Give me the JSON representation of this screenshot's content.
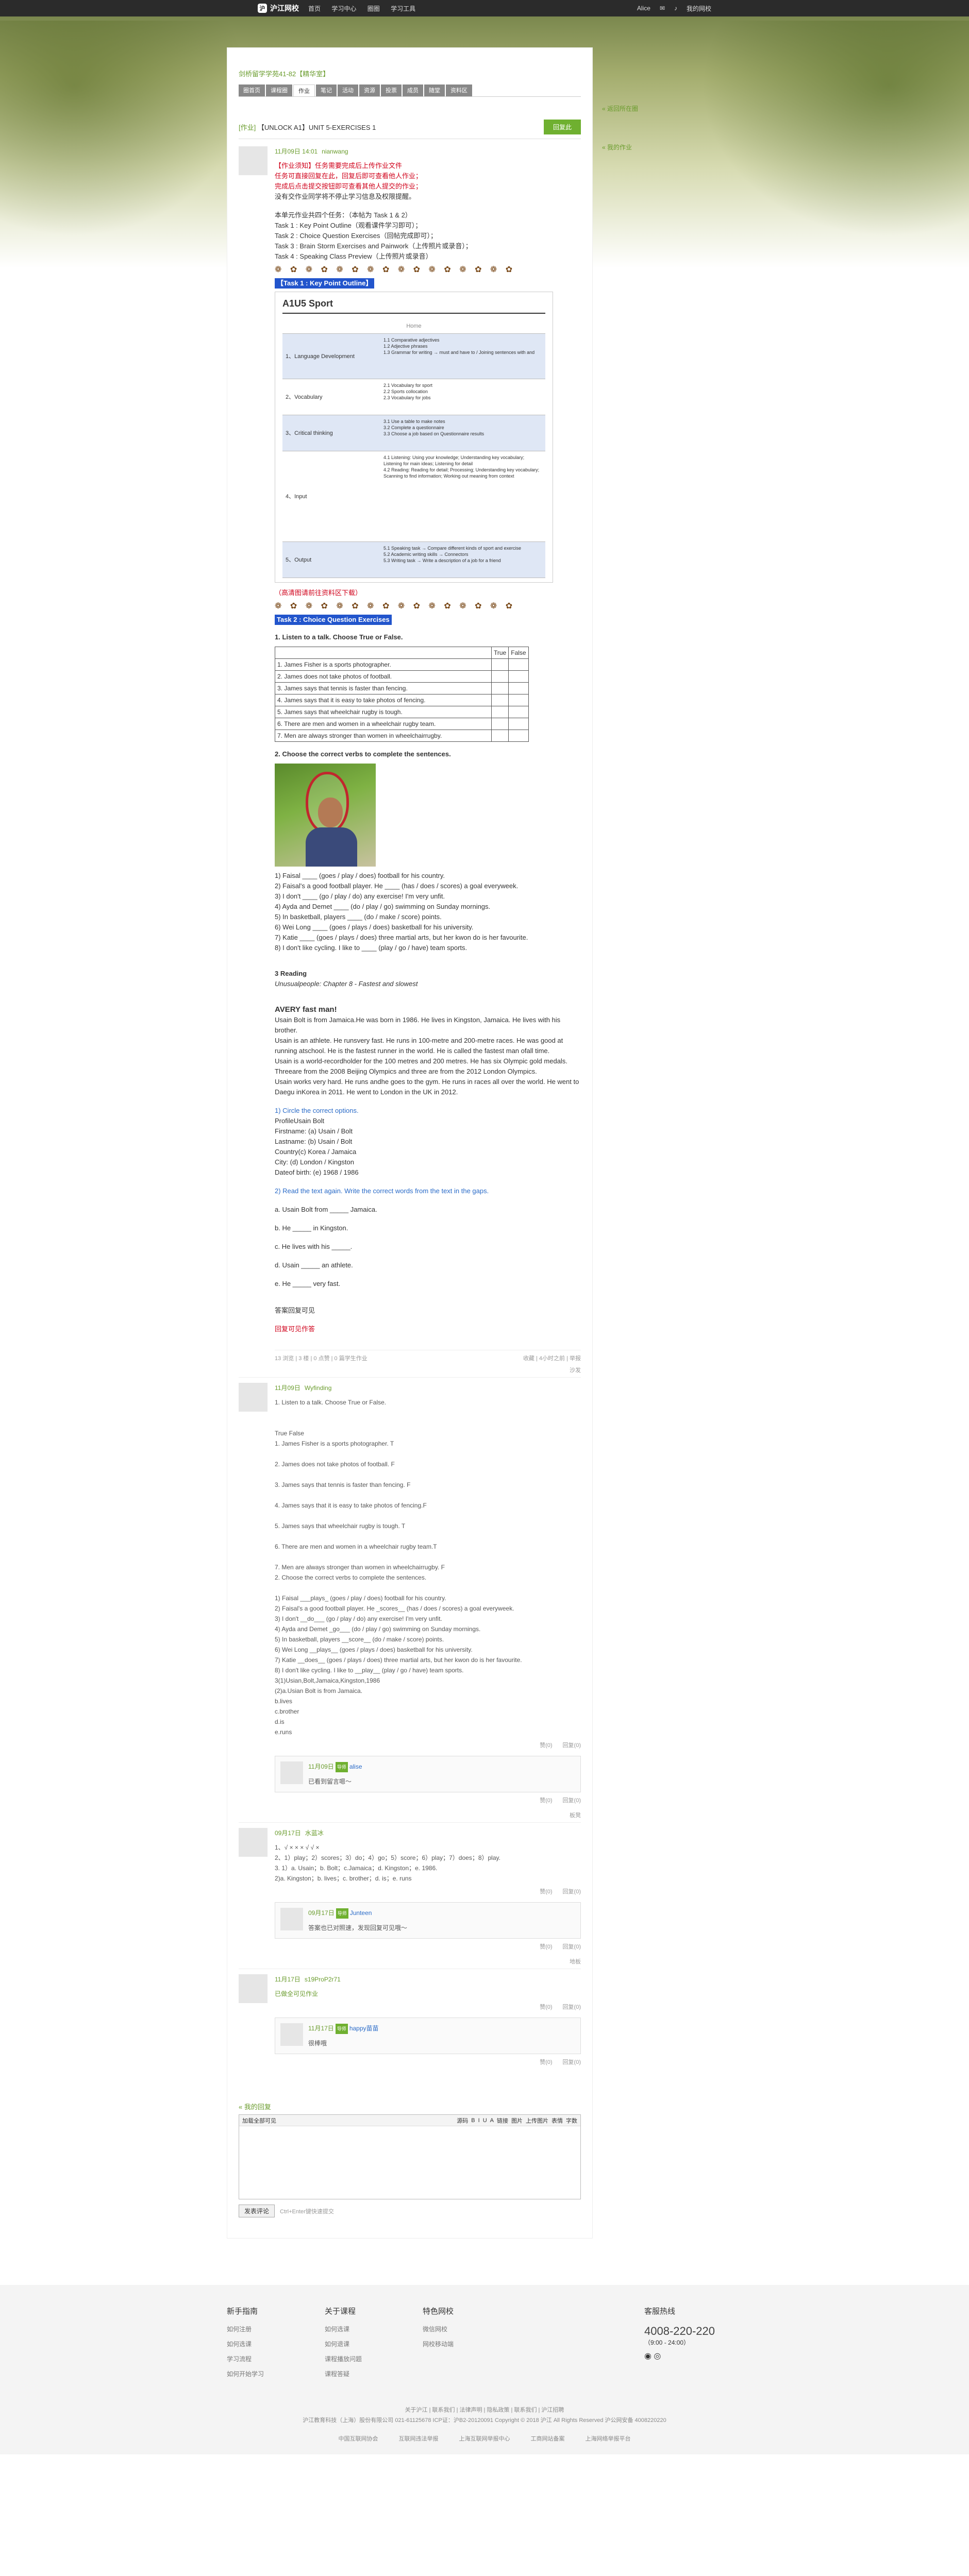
{
  "topbar": {
    "logo": "沪江网校",
    "nav": [
      "首页",
      "学习中心",
      "圈圈",
      "学习工具"
    ],
    "user": "Alice",
    "logout": "我的网校"
  },
  "group": {
    "title": "剑桥留学学苑41-82【精华室】",
    "tabs": [
      "圈首页",
      "课程圈",
      "作业",
      "笔记",
      "活动",
      "资源",
      "投票",
      "成员",
      "随堂",
      "资料区"
    ],
    "active_tab": 2
  },
  "side": {
    "back": "« 返回所在圈",
    "my": "« 我的作业"
  },
  "thread": {
    "label": "[作业]",
    "title": "【UNLOCK A1】UNIT 5-EXERCISES 1",
    "reply_button": "回复此"
  },
  "main_post": {
    "time": "11月09日 14:01",
    "user": "nianwang",
    "lines_red": [
      "【作业须知】任务需要完成后上传作业文件",
      "任务可直接回复在此，回复后即可查看他人作业；",
      "完成后点击提交按钮即可查看其他人提交的作业；"
    ],
    "line_black": "没有交作业同学将不停止学习信息及权限提醒。",
    "task_intro": "本单元作业共四个任务：（本帖为 Task 1 & 2）",
    "tasks": [
      "Task 1 : Key Point Outline（观看课件学习即可）；",
      "Task 2 : Choice Question Exercises（回帖完成即可）；",
      "Task 3 : Brain Storm Exercises and Painwork（上传照片或录音）；",
      "Task 4 : Speaking Class Preview（上传照片或录音）"
    ],
    "icons": "❁ ✿ ❁ ✿ ❁ ✿ ❁ ✿ ❁ ✿ ❁ ✿ ❁ ✿ ❁ ✿",
    "task1_bar": "【Task 1 : Key Point Outline】",
    "figure": {
      "title": "A1U5 Sport",
      "header": "Home",
      "rows": [
        {
          "label": "1、Language Development",
          "items": "1.1 Comparative adjectives\n1.2 Adjective phrases\n1.3 Grammar for writing → must and have to / Joining sentences with and"
        },
        {
          "label": "2、Vocabulary",
          "items": "2.1 Vocabulary for sport\n2.2 Sports collocation\n2.3 Vocabulary for jobs"
        },
        {
          "label": "3、Critical thinking",
          "items": "3.1 Use a table to make notes\n3.2 Complete a questionnaire\n3.3 Choose a job based on Questionnaire results"
        },
        {
          "label": "4、Input",
          "items": "4.1 Listening: Using your knowledge; Understanding key vocabulary; Listening for main ideas; Listening for detail\n4.2 Reading: Reading for detail; Processing; Understanding key vocabulary; Scanning to find information; Working out meaning from context"
        },
        {
          "label": "5、Output",
          "items": "5.1 Speaking task → Compare different kinds of sport and exercise\n5.2 Academic writing skills → Connectors\n5.3 Writing task → Write a description of a job for a friend"
        }
      ]
    },
    "figure_note": "（高清图请前往资料区下载）",
    "task2_bar": "Task 2 : Choice Question Exercises",
    "q1": "1.   Listen to a talk. Choose True or False.",
    "tf_head": [
      "",
      "True",
      "False"
    ],
    "tf_rows": [
      "1.  James Fisher is a sports photographer.",
      "2.  James does not take photos of football.",
      "3.  James says that tennis is faster than fencing.",
      "4.  James says that it is easy to take photos of fencing.",
      "5.  James says that wheelchair rugby is tough.",
      "6.  There are men and women in a wheelchair rugby team.",
      "7.  Men are always stronger than women in wheelchairrugby."
    ],
    "q2": "2.    Choose the correct verbs to complete the sentences.",
    "verbs": [
      "1) Faisal ____ (goes / play / does) football for his country.",
      "2) Faisal's a good football player. He ____ (has / does / scores) a goal everyweek.",
      "3) I don't ____ (go / play / do) any exercise! I'm very unfit.",
      "4) Ayda and Demet ____ (do / play / go) swimming on Sunday mornings.",
      "5) In basketball, players ____ (do / make / score) points.",
      "6) Wei Long ____ (goes / plays / does) basketball for his university.",
      "7) Katie ____ (goes / plays / does) three martial arts, but her kwon do is her favourite.",
      "8) I don't like cycling. I like to ____ (play / go / have) team sports."
    ],
    "reading_title": "3 Reading",
    "reading_sub": "Unusualpeople: Chapter 8 - Fastest and slowest",
    "article_title": "AVERY fast man!",
    "article": [
      "Usain Bolt is from Jamaica.He was born in 1986. He lives in Kingston, Jamaica. He lives with his brother.",
      "Usain is an athlete. He runsvery fast. He runs in 100-metre and 200-metre races. He was good at running atschool. He is the fastest runner in the world. He is called the fastest man ofall time.",
      "Usain is a world-recordholder for the 100 metres and 200 metres. He has six Olympic gold medals. Threeare from the 2008 Beijing Olympics and three are from the 2012 London Olympics.",
      "Usain works very hard. He runs andhe goes to the gym. He runs in races all over the world. He went to Daegu inKorea in 2011. He went to London in the UK in 2012."
    ],
    "circle_title": "1)   Circle the correct options.",
    "profile": [
      "ProfileUsain Bolt",
      "Firstname: (a) Usain / Bolt",
      "Lastname: (b) Usain / Bolt",
      "Country(c) Korea / Jamaica",
      "City: (d) London / Kingston",
      "Dateof birth: (e) 1968 / 1986"
    ],
    "read_again": "2)   Read the text again. Write the correct words from the text in the gaps.",
    "gaps": [
      "a. Usain Bolt from _____ Jamaica.",
      "b.  He _____ in Kingston.",
      "c.  He lives with his _____.",
      "d.  Usain _____ an athlete.",
      "e.  He _____ very fast."
    ],
    "end1": "答案回复可见",
    "end2": "回复可见作答",
    "foot_left": "13 浏览 | 3 楼 | 0 点赞 | 0 篇学生作业",
    "foot_right": "收藏  |  4小时之前 | 举报"
  },
  "replies": [
    {
      "floor": "沙发",
      "time": "11月09日",
      "user": "Wyfinding",
      "lines": [
        "1.  Listen to a talk. Choose True or False.",
        "",
        "",
        "True False",
        "1.  James Fisher is a sports photographer. T",
        "",
        "2.  James does not take photos of football. F",
        "",
        "3.  James says that tennis is faster than fencing. F",
        "",
        "4.  James says that it is easy to take photos of fencing.F",
        "",
        "5.  James says that wheelchair rugby is tough. T",
        "",
        "6.  There are men and women in a wheelchair rugby team.T",
        "",
        "7.  Men are always stronger than women in wheelchairrugby. F",
        "2.   Choose the correct verbs to complete the sentences.",
        "",
        "1) Faisal ___plays_ (goes / play / does) football for his country.",
        "2) Faisal's a good football player. He _scores__ (has / does / scores) a goal everyweek.",
        "3) I don't __do___ (go / play / do) any exercise! I'm very unfit.",
        "4) Ayda and Demet _go___ (do / play / go) swimming on Sunday mornings.",
        "5) In basketball, players __score__ (do / make / score) points.",
        "6) Wei Long __plays__ (goes / plays / does) basketball for his university.",
        "7) Katie __does__ (goes / plays / does) three martial arts, but her kwon do is her favourite.",
        "8) I don't like cycling. I like to __play__ (play / go / have) team sports.",
        "3(1)Usian,Bolt,Jamaica,Kingston,1986",
        "(2)a.Usian Bolt is from Jamaica.",
        "b.lives",
        "c.brother",
        "d.is",
        "e.runs"
      ],
      "sub": {
        "time": "11月09日",
        "tag": "导师",
        "user": "alise",
        "text": "已看到留言嗯～"
      }
    },
    {
      "floor": "板凳",
      "time": "09月17日",
      "user": "水蓝冰",
      "lines": [
        "1、√ × × × √ √ ×",
        "2、1）play；2）scores；3）do；4）go；5）score；6）play；7）does；8）play.",
        "3. 1）a. Usain；b. Bolt；c.Jamaica；d. Kingston；e. 1986.",
        "2)a. Kingston；b. lives；c. brother；d. is；e. runs"
      ],
      "sub": {
        "time": "09月17日",
        "tag": "导师",
        "user": "Junteen",
        "text": "答案也已对照速，发现回复可见哦～"
      }
    },
    {
      "floor": "地板",
      "time": "11月17日",
      "user": "s19ProP2r71",
      "lines": [
        "已做全可见作业"
      ],
      "sub": {
        "time": "11月17日",
        "tag": "导师",
        "user": "happy苗苗",
        "text": "很棒哦"
      }
    }
  ],
  "actions": {
    "like": "赞(0)",
    "reply": "回复(0)"
  },
  "my_reply": {
    "title": "« 我的回复",
    "placeholder": "加载全部可见",
    "toolbar": [
      "源码",
      "B",
      "I",
      "U",
      "A",
      "链接",
      "图片",
      "上传图片",
      "表情",
      "字数"
    ],
    "submit": "发表评论",
    "hint": "Ctrl+Enter键快速提交"
  },
  "footer": {
    "cols": [
      {
        "title": "新手指南",
        "links": [
          "如何注册",
          "如何选课",
          "学习流程",
          "如何开始学习"
        ]
      },
      {
        "title": "关于课程",
        "links": [
          "如何选课",
          "如何退课",
          "课程播放问题",
          "课程答疑"
        ]
      },
      {
        "title": "特色网校",
        "links": [
          "微信网校",
          "网校移动端"
        ]
      }
    ],
    "hotline_title": "客服热线",
    "hotline": "4008-220-220",
    "hotline_hours": "（9:00 - 24:00）",
    "links": "关于沪江 | 联系我们 | 法律声明 | 隐私政策 | 联系我们 | 沪江招聘",
    "copyright": "沪江教育科技（上海）股份有限公司 021-61125678  ICP证：沪B2-20120091  Copyright © 2018 沪江 All Rights Reserved  沪公网安备 4008220220",
    "badges": [
      "中国互联网协会",
      "互联网违法举报",
      "上海互联网举报中心",
      "工商网站备案",
      "上海网络举报平台"
    ]
  }
}
